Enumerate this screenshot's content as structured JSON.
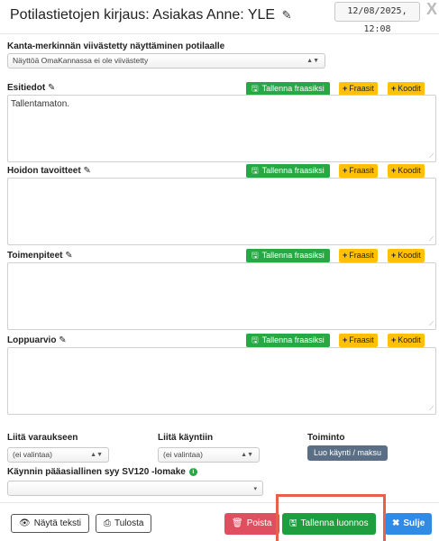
{
  "header": {
    "title": "Potilastietojen kirjaus: Asiakas Anne: YLE",
    "edit_icon": "✎",
    "date": "12/08/2025, 12:08",
    "close": "X"
  },
  "kanta": {
    "label": "Kanta-merkinnän viivästetty näyttäminen potilaalle",
    "selected": "Näyttöä OmaKannassa ei ole viivästetty"
  },
  "sections": [
    {
      "label": "Esitiedot",
      "text": "Tallentamaton.",
      "save": "Tallenna fraasiksi",
      "fraasit": "Fraasit",
      "koodit": "Koodit"
    },
    {
      "label": "Hoidon tavoitteet",
      "text": "",
      "save": "Tallenna fraasiksi",
      "fraasit": "Fraasit",
      "koodit": "Koodit"
    },
    {
      "label": "Toimenpiteet",
      "text": "",
      "save": "Tallenna fraasiksi",
      "fraasit": "Fraasit",
      "koodit": "Koodit"
    },
    {
      "label": "Loppuarvio",
      "text": "",
      "save": "Tallenna fraasiksi",
      "fraasit": "Fraasit",
      "koodit": "Koodit"
    }
  ],
  "attach": {
    "varaus_label": "Liitä varaukseen",
    "varaus_value": "(ei valintaa)",
    "kaynti_label": "Liitä käyntiin",
    "kaynti_value": "(ei valintaa)",
    "toiminto_label": "Toiminto",
    "toiminto_button": "Luo käynti / maksu",
    "syy_label": "Käynnin pääasiallinen syy SV120 -lomake",
    "syy_value": ""
  },
  "footer": {
    "show_text": "Näytä teksti",
    "print": "Tulosta",
    "delete": "Poista",
    "save_draft": "Tallenna luonnos",
    "close": "Sulje"
  },
  "colors": {
    "green": "#28a745",
    "yellow": "#ffc107",
    "red": "#e04f5f",
    "blue": "#2f8be6",
    "highlight": "#e8604c"
  }
}
